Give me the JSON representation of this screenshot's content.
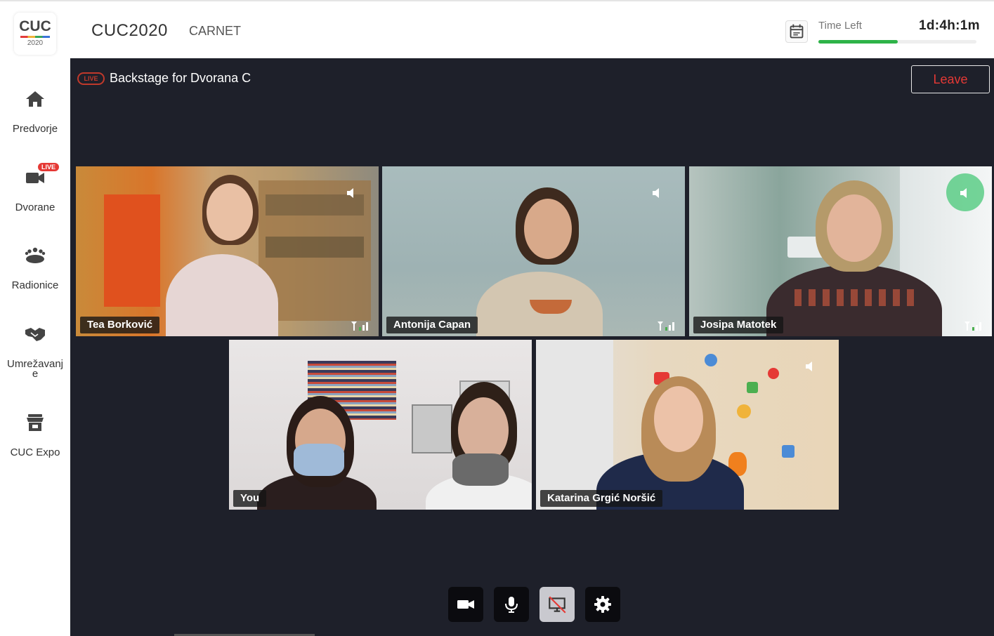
{
  "logo": {
    "text": "CUC",
    "year": "2020"
  },
  "sidebar": {
    "items": [
      {
        "label": "Predvorje",
        "icon": "home-icon"
      },
      {
        "label": "Dvorane",
        "icon": "video-camera-icon",
        "badge": "LIVE"
      },
      {
        "label": "Radionice",
        "icon": "group-icon"
      },
      {
        "label": "Umrežavanje",
        "label_lines": [
          "Umrežavanj",
          "e"
        ],
        "icon": "handshake-icon"
      },
      {
        "label": "CUC Expo",
        "icon": "store-icon"
      }
    ]
  },
  "header": {
    "event_title": "CUC2020",
    "organization": "CARNET",
    "time_left_label": "Time Left",
    "time_left_value": "1d:4h:1m",
    "time_progress": 0.5
  },
  "stage": {
    "live_label": "LIVE",
    "title": "Backstage for Dvorana C",
    "leave_label": "Leave"
  },
  "participants": [
    {
      "name": "Tea Borković",
      "muted": true,
      "speaking": false
    },
    {
      "name": "Antonija Capan",
      "muted": true,
      "speaking": false
    },
    {
      "name": "Josipa Matotek",
      "muted": false,
      "speaking": true
    },
    {
      "name": "You",
      "muted": false,
      "speaking": false
    },
    {
      "name": "Katarina Grgić Noršić",
      "muted": true,
      "speaking": false
    }
  ],
  "controls": [
    {
      "name": "camera",
      "icon": "video-camera-icon",
      "enabled": true
    },
    {
      "name": "microphone",
      "icon": "microphone-icon",
      "enabled": true
    },
    {
      "name": "screen-share",
      "icon": "screen-share-off-icon",
      "enabled": false
    },
    {
      "name": "settings",
      "icon": "gear-icon",
      "enabled": true
    }
  ],
  "colors": {
    "stage_bg": "#1e202a",
    "live_red": "#e53935",
    "progress_green": "#2eb348",
    "speaking_green": "#48c878"
  }
}
